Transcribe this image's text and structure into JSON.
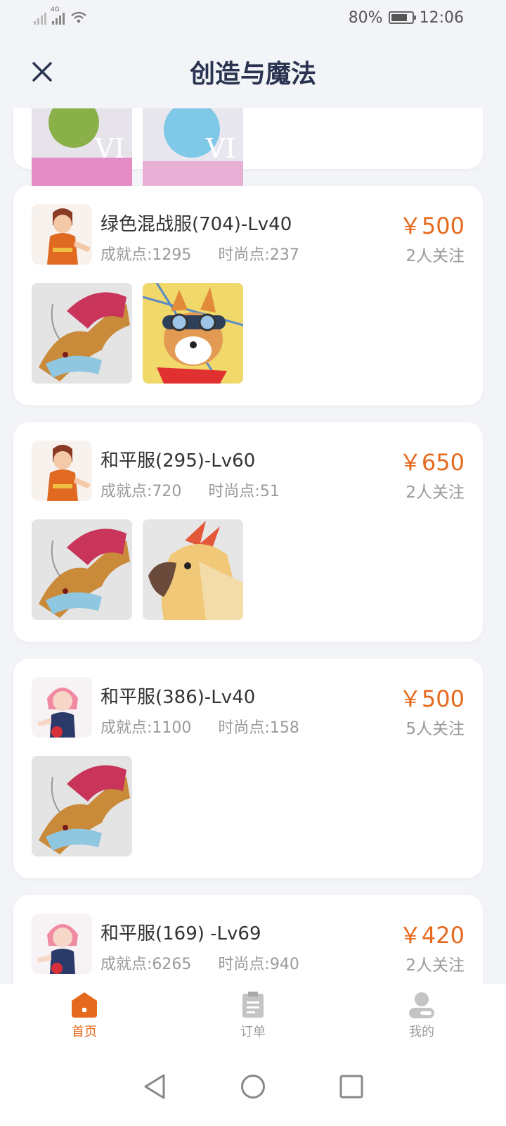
{
  "status_bar": {
    "network_label": "4G",
    "battery": "80%",
    "time": "12:06",
    "battery_level": 0.8
  },
  "header": {
    "title": "创造与魔法",
    "close_icon": "close-icon"
  },
  "listings": [
    {
      "title": "绿色混战服(704)-Lv40",
      "achievement": "成就点:1295",
      "fashion": "时尚点:237",
      "price": "￥500",
      "followers": "2人关注",
      "avatar": "boy-character",
      "thumbs": [
        "dragon-mount",
        "corgi-pilot-pet"
      ]
    },
    {
      "title": "和平服(295)-Lv60",
      "achievement": "成就点:720",
      "fashion": "时尚点:51",
      "price": "￥650",
      "followers": "2人关注",
      "avatar": "boy-character",
      "thumbs": [
        "dragon-mount",
        "golden-parrot-mount"
      ]
    },
    {
      "title": "和平服(386)-Lv40",
      "achievement": "成就点:1100",
      "fashion": "时尚点:158",
      "price": "￥500",
      "followers": "5人关注",
      "avatar": "girl-character",
      "thumbs": [
        "dragon-mount"
      ]
    },
    {
      "title": "和平服(169) -Lv69",
      "achievement": "成就点:6265",
      "fashion": "时尚点:940",
      "price": "￥420",
      "followers": "2人关注",
      "avatar": "girl-character",
      "thumbs": []
    }
  ],
  "partial_card": {
    "badge_text": "VI"
  },
  "bottom_nav": {
    "items": [
      {
        "label": "首页",
        "icon": "home-icon",
        "active": true
      },
      {
        "label": "订单",
        "icon": "clipboard-icon",
        "active": false
      },
      {
        "label": "我的",
        "icon": "user-icon",
        "active": false
      }
    ]
  },
  "colors": {
    "accent": "#e66a1e",
    "title": "#2a3450",
    "muted": "#9a9a9a",
    "background": "#f2f4f7"
  }
}
